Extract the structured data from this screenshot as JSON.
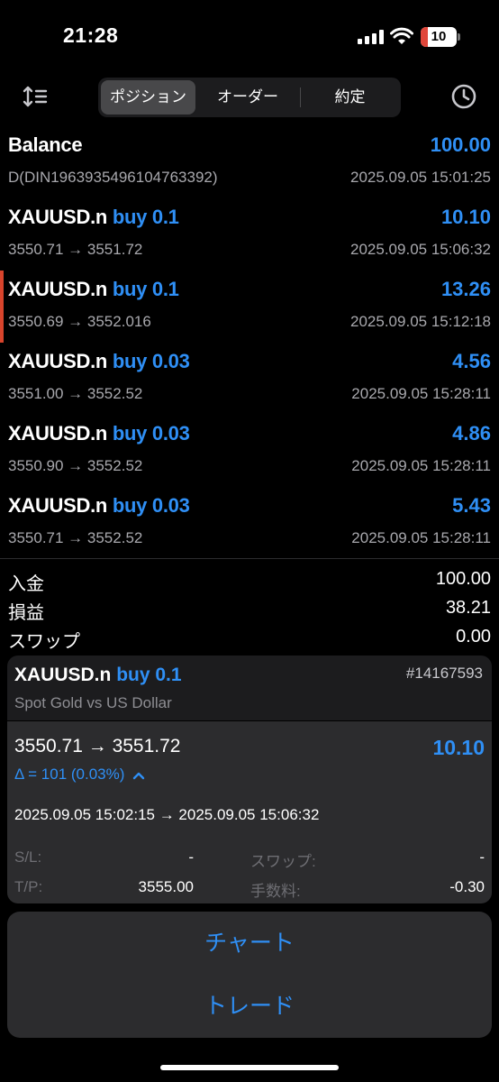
{
  "status": {
    "time": "21:28",
    "battery": "10"
  },
  "toolbar": {
    "tabs": [
      {
        "label": "ポジション"
      },
      {
        "label": "オーダー"
      },
      {
        "label": "約定"
      }
    ],
    "active_tab": 0
  },
  "balance": {
    "label": "Balance",
    "value": "100.00",
    "ref": "D(DIN1963935496104763392)",
    "time": "2025.09.05 15:01:25"
  },
  "positions": [
    {
      "symbol": "XAUUSD.n",
      "side": "buy 0.1",
      "profit": "10.10",
      "prices": "3550.71 → 3551.72",
      "time": "2025.09.05 15:06:32",
      "selected": false
    },
    {
      "symbol": "XAUUSD.n",
      "side": "buy 0.1",
      "profit": "13.26",
      "prices": "3550.69 → 3552.016",
      "time": "2025.09.05 15:12:18",
      "selected": true
    },
    {
      "symbol": "XAUUSD.n",
      "side": "buy 0.03",
      "profit": "4.56",
      "prices": "3551.00 → 3552.52",
      "time": "2025.09.05 15:28:11",
      "selected": false
    },
    {
      "symbol": "XAUUSD.n",
      "side": "buy 0.03",
      "profit": "4.86",
      "prices": "3550.90 → 3552.52",
      "time": "2025.09.05 15:28:11",
      "selected": false
    },
    {
      "symbol": "XAUUSD.n",
      "side": "buy 0.03",
      "profit": "5.43",
      "prices": "3550.71 → 3552.52",
      "time": "2025.09.05 15:28:11",
      "selected": false
    }
  ],
  "summary": [
    {
      "label": "入金",
      "value": "100.00"
    },
    {
      "label": "損益",
      "value": "38.21"
    },
    {
      "label": "スワップ",
      "value": "0.00"
    }
  ],
  "detail": {
    "symbol": "XAUUSD.n",
    "side": "buy 0.1",
    "ticket": "#14167593",
    "description": "Spot Gold vs US Dollar",
    "prices": "3550.71 → 3551.72",
    "profit": "10.10",
    "delta": "Δ = 101 (0.03%)",
    "times": "2025.09.05 15:02:15 → 2025.09.05 15:06:32",
    "sl_label": "S/L:",
    "sl_value": "-",
    "tp_label": "T/P:",
    "tp_value": "3555.00",
    "swap_label": "スワップ:",
    "swap_value": "-",
    "fee_label": "手数料:",
    "fee_value": "-0.30"
  },
  "actions": {
    "chart": "チャート",
    "trade": "トレード"
  },
  "colors": {
    "accent": "#2f8ff5",
    "marker": "#d8442c",
    "panel": "#2c2c2e"
  }
}
